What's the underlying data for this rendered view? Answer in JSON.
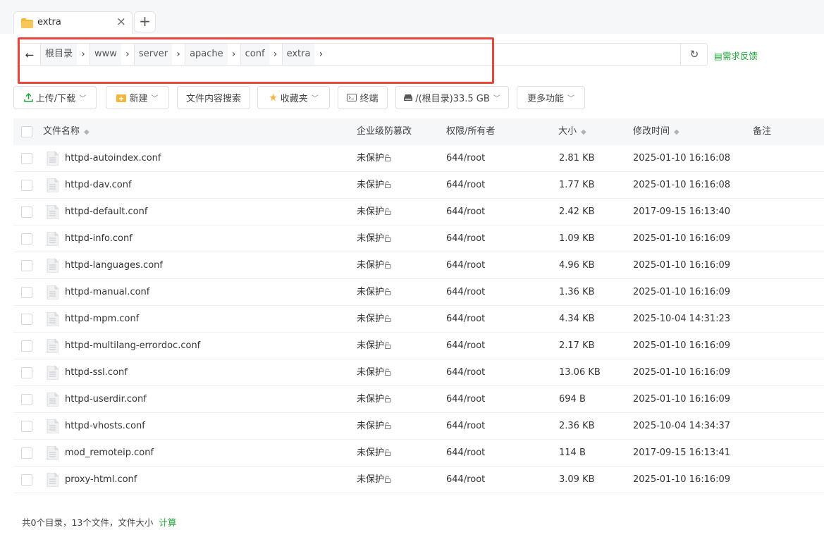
{
  "tab": {
    "label": "extra",
    "close": "×",
    "add": "+"
  },
  "path": {
    "back": "←",
    "crumbs": [
      "根目录",
      "www",
      "server",
      "apache",
      "conf",
      "extra"
    ],
    "separator": "›",
    "refresh": "↻"
  },
  "feedback": {
    "icon": "▤",
    "label": "需求反馈"
  },
  "toolbar": {
    "upload": "上传/下载",
    "new": "新建",
    "search": "文件内容搜索",
    "favorites": "收藏夹",
    "terminal": "终端",
    "disk": "/(根目录)33.5 GB",
    "more": "更多功能"
  },
  "columns": {
    "name": "文件名称",
    "tamper": "企业级防篡改",
    "perm": "权限/所有者",
    "size": "大小",
    "mtime": "修改时间",
    "note": "备注"
  },
  "files": [
    {
      "name": "httpd-autoindex.conf",
      "tamper": "未保护",
      "perm": "644/root",
      "size": "2.81 KB",
      "mtime": "2025-01-10 16:16:08"
    },
    {
      "name": "httpd-dav.conf",
      "tamper": "未保护",
      "perm": "644/root",
      "size": "1.77 KB",
      "mtime": "2025-01-10 16:16:08"
    },
    {
      "name": "httpd-default.conf",
      "tamper": "未保护",
      "perm": "644/root",
      "size": "2.42 KB",
      "mtime": "2017-09-15 16:13:40"
    },
    {
      "name": "httpd-info.conf",
      "tamper": "未保护",
      "perm": "644/root",
      "size": "1.09 KB",
      "mtime": "2025-01-10 16:16:09"
    },
    {
      "name": "httpd-languages.conf",
      "tamper": "未保护",
      "perm": "644/root",
      "size": "4.96 KB",
      "mtime": "2025-01-10 16:16:09"
    },
    {
      "name": "httpd-manual.conf",
      "tamper": "未保护",
      "perm": "644/root",
      "size": "1.36 KB",
      "mtime": "2025-01-10 16:16:09"
    },
    {
      "name": "httpd-mpm.conf",
      "tamper": "未保护",
      "perm": "644/root",
      "size": "4.34 KB",
      "mtime": "2025-10-04 14:31:23"
    },
    {
      "name": "httpd-multilang-errordoc.conf",
      "tamper": "未保护",
      "perm": "644/root",
      "size": "2.17 KB",
      "mtime": "2025-01-10 16:16:09"
    },
    {
      "name": "httpd-ssl.conf",
      "tamper": "未保护",
      "perm": "644/root",
      "size": "13.06 KB",
      "mtime": "2025-01-10 16:16:09"
    },
    {
      "name": "httpd-userdir.conf",
      "tamper": "未保护",
      "perm": "644/root",
      "size": "694 B",
      "mtime": "2025-01-10 16:16:09"
    },
    {
      "name": "httpd-vhosts.conf",
      "tamper": "未保护",
      "perm": "644/root",
      "size": "2.36 KB",
      "mtime": "2025-10-04 14:34:37"
    },
    {
      "name": "mod_remoteip.conf",
      "tamper": "未保护",
      "perm": "644/root",
      "size": "114 B",
      "mtime": "2017-09-15 16:13:41"
    },
    {
      "name": "proxy-html.conf",
      "tamper": "未保护",
      "perm": "644/root",
      "size": "3.09 KB",
      "mtime": "2025-01-10 16:16:09"
    }
  ],
  "footer": {
    "summary": "共0个目录，13个文件，文件大小",
    "calc": "计算"
  },
  "colors": {
    "accent": "#20a53a",
    "highlight": "#e8453c",
    "folder": "#f5b63a"
  }
}
